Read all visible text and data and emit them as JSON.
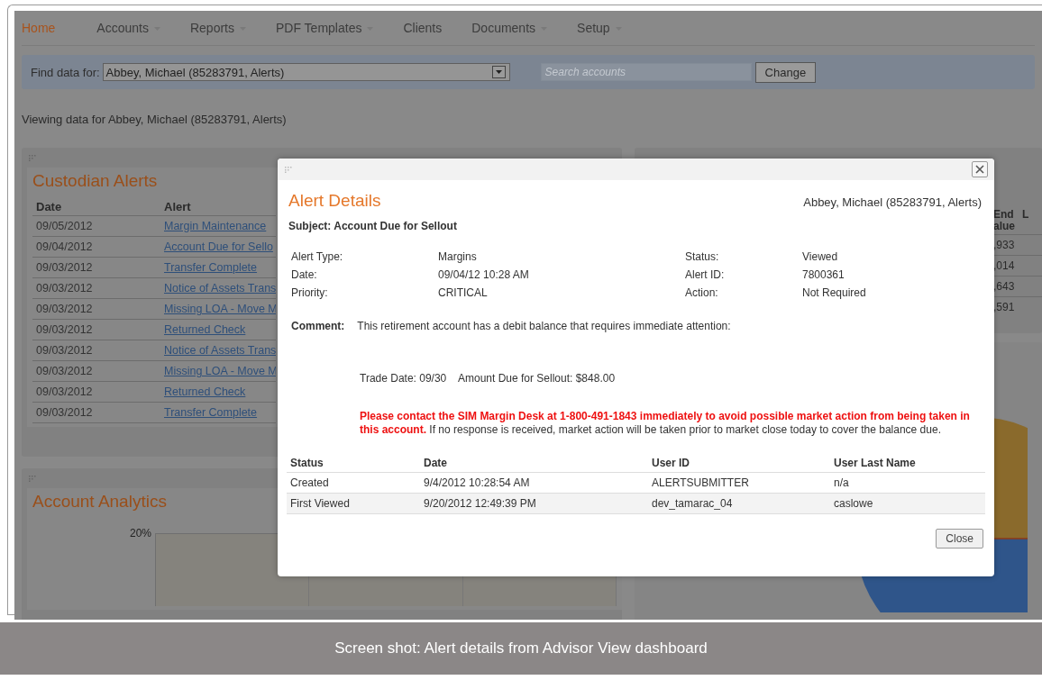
{
  "nav": {
    "items": [
      {
        "label": "Home",
        "selected": true,
        "has_menu": false
      },
      {
        "label": "Accounts",
        "selected": false,
        "has_menu": true
      },
      {
        "label": "Reports",
        "selected": false,
        "has_menu": true
      },
      {
        "label": "PDF Templates",
        "selected": false,
        "has_menu": true
      },
      {
        "label": "Clients",
        "selected": false,
        "has_menu": false
      },
      {
        "label": "Documents",
        "selected": false,
        "has_menu": true
      },
      {
        "label": "Setup",
        "selected": false,
        "has_menu": true
      }
    ]
  },
  "find_bar": {
    "label": "Find data for:",
    "account": "Abbey, Michael (85283791, Alerts)",
    "search_placeholder": "Search accounts",
    "button": "Change"
  },
  "viewing_text": "Viewing data for Abbey, Michael (85283791, Alerts)",
  "custodian_alerts": {
    "title": "Custodian Alerts",
    "columns": [
      "Date",
      "Alert"
    ],
    "rows": [
      {
        "date": "09/05/2012",
        "alert": "Margin Maintenance"
      },
      {
        "date": "09/04/2012",
        "alert": "Account Due for Sello"
      },
      {
        "date": "09/03/2012",
        "alert": "Transfer Complete"
      },
      {
        "date": "09/03/2012",
        "alert": "Notice of Assets Trans"
      },
      {
        "date": "09/03/2012",
        "alert": "Missing LOA - Move M"
      },
      {
        "date": "09/03/2012",
        "alert": "Returned Check"
      },
      {
        "date": "09/03/2012",
        "alert": "Notice of Assets Trans"
      },
      {
        "date": "09/03/2012",
        "alert": "Missing LOA - Move M"
      },
      {
        "date": "09/03/2012",
        "alert": "Returned Check"
      },
      {
        "date": "09/03/2012",
        "alert": "Transfer Complete"
      }
    ]
  },
  "account_analytics": {
    "title": "Account Analytics",
    "y_tick": "20%"
  },
  "right_table": {
    "columns": [
      "End alue",
      "L"
    ],
    "rows": [
      ",933",
      ",014",
      ",643",
      ",591"
    ]
  },
  "dialog": {
    "title": "Alert Details",
    "account": "Abbey, Michael (85283791, Alerts)",
    "subject": "Subject: Account Due for Sellout",
    "fields_left": [
      {
        "label": "Alert Type:",
        "value": "Margins"
      },
      {
        "label": "Date:",
        "value": "09/04/12 10:28 AM"
      },
      {
        "label": "Priority:",
        "value": "CRITICAL"
      }
    ],
    "fields_right": [
      {
        "label": "Status:",
        "value": "Viewed"
      },
      {
        "label": "Alert ID:",
        "value": "7800361"
      },
      {
        "label": "Action:",
        "value": "Not Required"
      }
    ],
    "comment_label": "Comment:",
    "comment": "This retirement account has a debit balance that requires immediate attention:",
    "trade_line": "Trade Date: 09/30    Amount Due for Sellout: $848.00",
    "message": "**Please contact the SIM Margin Desk at 1-800-491-1843 immediately to avoid possible market action from being taken in this account.** If no response is received, market action will be taken prior to market close today to cover the balance due.",
    "history": {
      "columns": [
        "Status",
        "Date",
        "User ID",
        "User Last Name"
      ],
      "rows": [
        [
          "Created",
          "9/4/2012 10:28:54 AM",
          "ALERTSUBMITTER",
          "n/a"
        ],
        [
          "First Viewed",
          "9/20/2012 12:49:39 PM",
          "dev_tamarac_04",
          "caslowe"
        ]
      ]
    },
    "close_button": "Close"
  },
  "caption": "Screen shot: Alert details from Advisor View dashboard"
}
